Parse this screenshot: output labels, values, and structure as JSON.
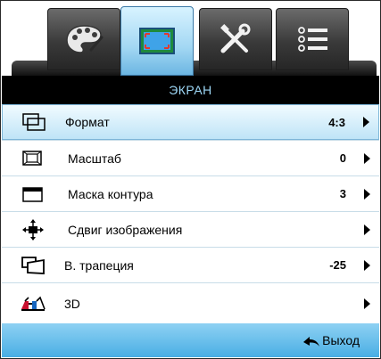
{
  "tabs": [
    {
      "icon": "palette-icon",
      "active": false
    },
    {
      "icon": "display-screen-icon",
      "active": true
    },
    {
      "icon": "tools-icon",
      "active": false
    },
    {
      "icon": "options-list-icon",
      "active": false
    }
  ],
  "title": "ЭКРАН",
  "menu": [
    {
      "label": "Формат",
      "value": "4:3",
      "icon": "aspect-ratio-icon",
      "selected": true
    },
    {
      "label": "Масштаб",
      "value": "0",
      "icon": "zoom-frame-icon",
      "selected": false
    },
    {
      "label": "Маска контура",
      "value": "3",
      "icon": "edge-mask-icon",
      "selected": false
    },
    {
      "label": "Сдвиг изображения",
      "value": "",
      "icon": "image-shift-icon",
      "selected": false
    },
    {
      "label": "В. трапеция",
      "value": "-25",
      "icon": "keystone-icon",
      "selected": false
    },
    {
      "label": "3D",
      "value": "",
      "icon": "3d-glasses-icon",
      "selected": false
    }
  ],
  "footer": {
    "exit_label": "Выход",
    "exit_icon": "back-arrow-icon"
  }
}
